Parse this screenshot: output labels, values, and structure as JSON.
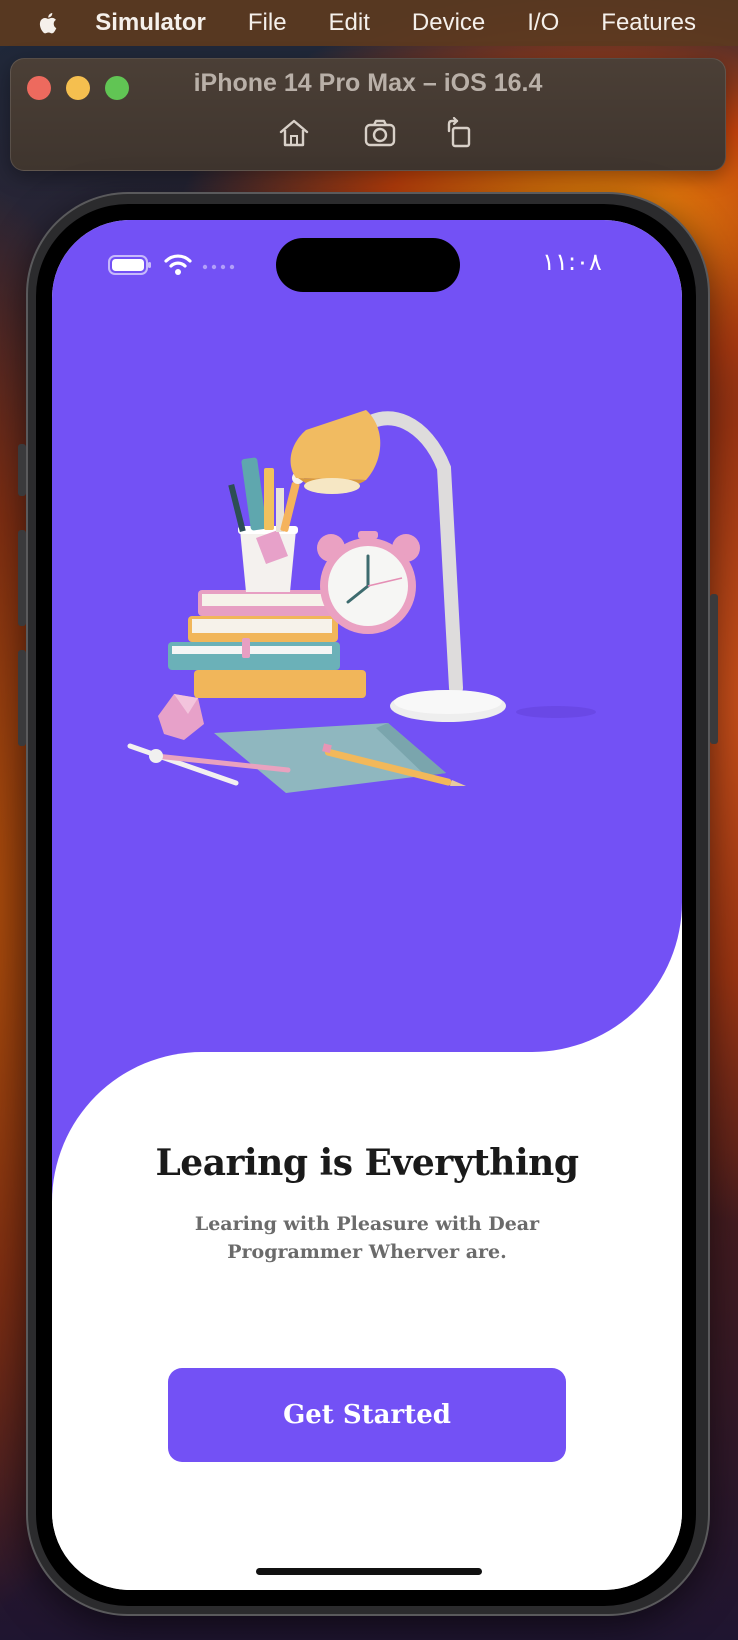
{
  "menubar": {
    "apple_icon": "apple-logo-icon",
    "items": [
      {
        "label": "Simulator",
        "bold": true
      },
      {
        "label": "File"
      },
      {
        "label": "Edit"
      },
      {
        "label": "Device"
      },
      {
        "label": "I/O"
      },
      {
        "label": "Features"
      }
    ]
  },
  "simulator_window": {
    "title": "iPhone 14 Pro Max – iOS 16.4",
    "toolbar_icons": [
      "home-icon",
      "screenshot-icon",
      "rotate-icon"
    ],
    "traffic_lights": {
      "close": "#ed6a5e",
      "minimize": "#f5bf4f",
      "zoom": "#61c554"
    }
  },
  "status_bar": {
    "time": "١١:٠٨",
    "icons": [
      "battery-icon",
      "wifi-icon",
      "signal-icon"
    ]
  },
  "onboarding": {
    "illustration": "study-desk-illustration",
    "title": "Learing is Everything",
    "subtitle": "Learing with Pleasure with Dear Programmer Wherver are.",
    "cta_label": "Get Started"
  },
  "colors": {
    "accent": "#7351f5",
    "title_text": "#1a1a1a",
    "subtitle_text": "#6b6b6b",
    "background": "#ffffff"
  }
}
